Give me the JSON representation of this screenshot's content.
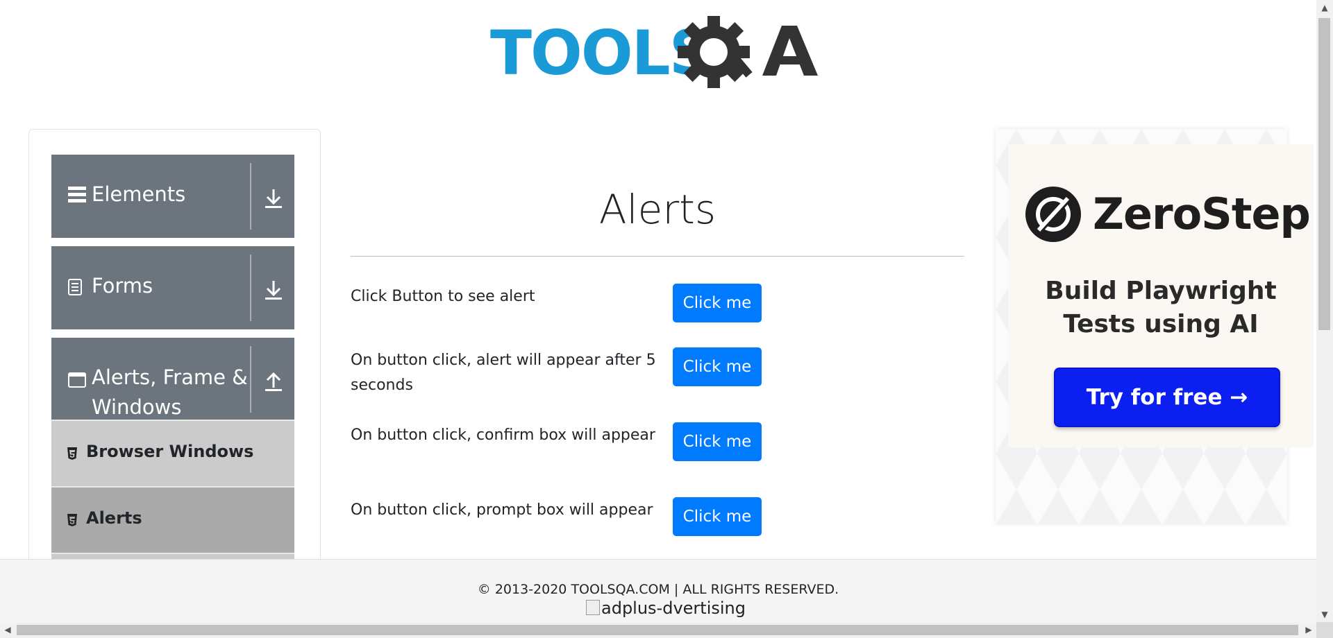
{
  "logo": {
    "text_tools": "TOOLS",
    "text_qa": "QA"
  },
  "sidebar": {
    "groups": [
      {
        "label": "Elements",
        "icon": "hamburger-icon",
        "toggle_icon": "arrow-down-tray-icon"
      },
      {
        "label": "Forms",
        "icon": "document-icon",
        "toggle_icon": "arrow-down-tray-icon"
      },
      {
        "label_line1": "Alerts, Frame &",
        "label_line2": "Windows",
        "icon": "browser-window-icon",
        "toggle_icon": "arrow-up-tray-icon"
      }
    ],
    "items": [
      {
        "label": "Browser Windows",
        "icon": "html5-icon",
        "active": false
      },
      {
        "label": "Alerts",
        "icon": "html5-icon",
        "active": true
      }
    ]
  },
  "main": {
    "title": "Alerts",
    "rows": [
      {
        "description": "Click Button to see alert",
        "button_label": "Click me"
      },
      {
        "description": "On button click, alert will appear after 5 seconds",
        "button_label": "Click me"
      },
      {
        "description": "On button click, confirm box will appear",
        "button_label": "Click me"
      },
      {
        "description": "On button click, prompt box will appear",
        "button_label": "Click me"
      }
    ]
  },
  "ad": {
    "brand": "ZeroStep",
    "headline_line1": "Build Playwright",
    "headline_line2": "Tests using AI",
    "cta_label": "Try for free →",
    "cta_color": "#0b1ff0"
  },
  "footer": {
    "copyright": "© 2013-2020 TOOLSQA.COM | ALL RIGHTS RESERVED.",
    "ad_image_alt": "adplus-dvertising"
  },
  "colors": {
    "primary_button": "#007bff",
    "sidebar_group": "#6c757d",
    "logo_blue": "#1b9ad8",
    "logo_dark": "#333333"
  }
}
